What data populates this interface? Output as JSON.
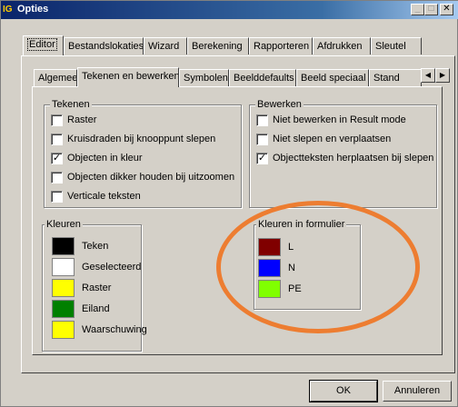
{
  "window": {
    "title": "Opties",
    "app_icon": "IG"
  },
  "tabs_top": [
    "Editor",
    "Bestandslokaties",
    "Wizard",
    "Berekening",
    "Rapporteren",
    "Afdrukken",
    "Sleutel"
  ],
  "tabs_inner": [
    "Algemeen",
    "Tekenen en bewerken",
    "Symbolen",
    "Beelddefaults",
    "Beeld speciaal",
    "Stand"
  ],
  "tekenen": {
    "label": "Tekenen",
    "items": [
      {
        "label": "Raster",
        "checked": false
      },
      {
        "label": "Kruisdraden bij knooppunt slepen",
        "checked": false
      },
      {
        "label": "Objecten in kleur",
        "checked": true
      },
      {
        "label": "Objecten dikker houden bij uitzoomen",
        "checked": false
      },
      {
        "label": "Verticale teksten",
        "checked": false
      }
    ]
  },
  "bewerken": {
    "label": "Bewerken",
    "items": [
      {
        "label": "Niet bewerken in Result mode",
        "checked": false
      },
      {
        "label": "Niet slepen en verplaatsen",
        "checked": false
      },
      {
        "label": "Objectteksten herplaatsen bij slepen",
        "checked": true
      }
    ]
  },
  "kleuren": {
    "label": "Kleuren",
    "items": [
      {
        "label": "Teken",
        "color": "#000000"
      },
      {
        "label": "Geselecteerd",
        "color": "#ffffff"
      },
      {
        "label": "Raster",
        "color": "#ffff00"
      },
      {
        "label": "Eiland",
        "color": "#008000"
      },
      {
        "label": "Waarschuwing",
        "color": "#ffff00"
      }
    ]
  },
  "kleuren_formulier": {
    "label": "Kleuren in formulier",
    "items": [
      {
        "label": "L",
        "color": "#800000"
      },
      {
        "label": "N",
        "color": "#0000ff"
      },
      {
        "label": "PE",
        "color": "#80ff00"
      }
    ]
  },
  "buttons": {
    "ok": "OK",
    "cancel": "Annuleren"
  },
  "annotation_color": "#ed7d31"
}
